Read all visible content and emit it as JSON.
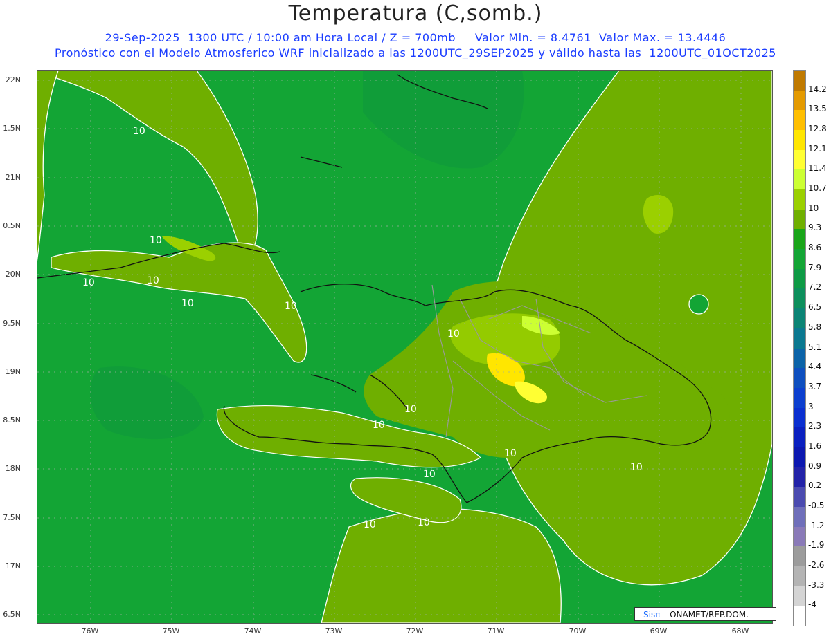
{
  "title": "Temperatura (C,somb.)",
  "subtitle1": "29-Sep-2025  1300 UTC / 10:00 am Hora Local / Z = 700mb     Valor Min. = 8.4761  Valor Max. = 13.4446",
  "subtitle2": "Pronóstico con el Modelo Atmosferico WRF inicializado a las 1200UTC_29SEP2025 y válido hasta las  1200UTC_01OCT2025",
  "lat_labels": [
    "22N",
    "1.5N",
    "21N",
    "0.5N",
    "20N",
    "9.5N",
    "19N",
    "8.5N",
    "18N",
    "7.5N",
    "17N",
    "6.5N"
  ],
  "lon_labels": [
    "76W",
    "75W",
    "74W",
    "73W",
    "72W",
    "71W",
    "70W",
    "69W",
    "68W"
  ],
  "contour_labels": [
    "10",
    "10",
    "10",
    "10",
    "10",
    "10",
    "10",
    "10",
    "10",
    "10",
    "10",
    "10",
    "10",
    "10"
  ],
  "colorbar": {
    "labels": [
      "14.2",
      "13.5",
      "12.8",
      "12.1",
      "11.4",
      "10.7",
      "10",
      "9.3",
      "8.6",
      "7.9",
      "7.2",
      "6.5",
      "5.8",
      "5.1",
      "4.4",
      "3.7",
      "3",
      "2.3",
      "1.6",
      "0.9",
      "0.2",
      "-0.5",
      "-1.2",
      "-1.9",
      "-2.6",
      "-3.3",
      "-4"
    ],
    "colors": [
      "#c07a00",
      "#e49a00",
      "#ffbf00",
      "#ffe600",
      "#ffff33",
      "#ccff33",
      "#9bd000",
      "#6faf00",
      "#19a519",
      "#13a535",
      "#0e9a45",
      "#0d8f5c",
      "#0b8475",
      "#0a7890",
      "#0b63a8",
      "#0e4fbf",
      "#0c3fcf",
      "#0a2fd0",
      "#0a20c0",
      "#0c18b0",
      "#2323a8",
      "#4b4bb0",
      "#6f6fba",
      "#8a7ab8",
      "#9c9c9c",
      "#b4b4b4",
      "#d4d4d4",
      "#ffffff"
    ]
  },
  "credit": {
    "sis": "Sisπ",
    "org": " – ONAMET/REP.DOM."
  }
}
